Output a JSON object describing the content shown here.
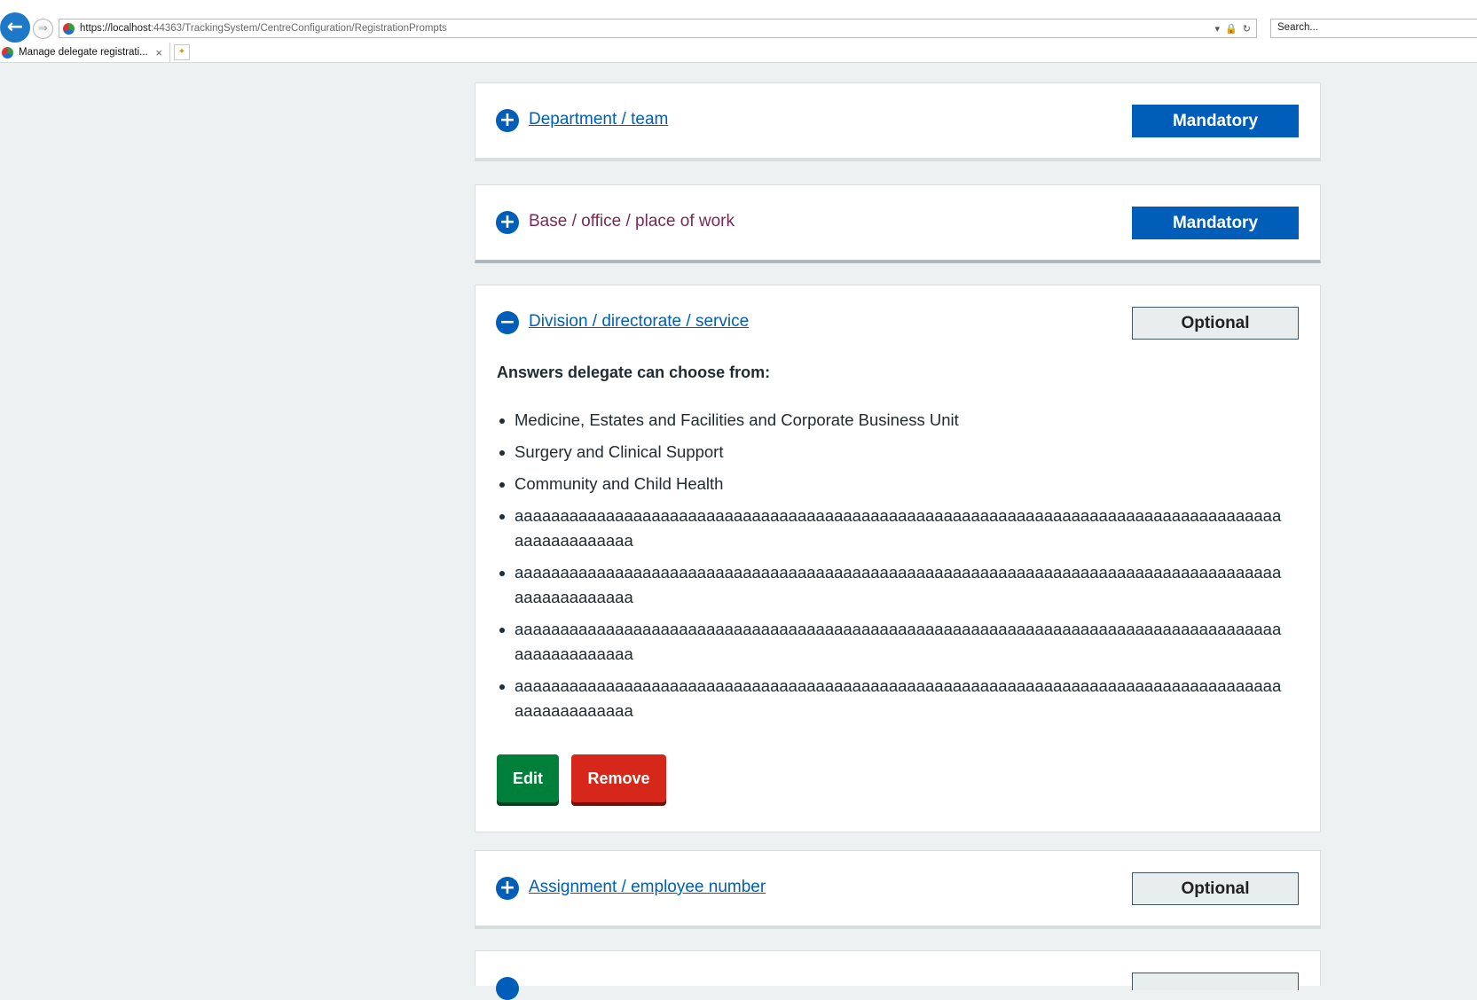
{
  "browser": {
    "url_host": "https://localhost",
    "url_rest": ":44363/TrackingSystem/CentreConfiguration/RegistrationPrompts",
    "search_placeholder": "Search...",
    "tab_title": "Manage delegate registrati...",
    "tab_close": "×"
  },
  "prompts": [
    {
      "title": "Department / team",
      "tag": "Mandatory"
    },
    {
      "title": "Base / office / place of work",
      "tag": "Mandatory"
    },
    {
      "title": "Division / directorate / service",
      "tag": "Optional",
      "answers_title": "Answers delegate can choose from:",
      "answers": [
        "Medicine, Estates and Facilities and Corporate Business Unit",
        "Surgery and Clinical Support",
        "Community and Child Health",
        "aaaaaaaaaaaaaaaaaaaaaaaaaaaaaaaaaaaaaaaaaaaaaaaaaaaaaaaaaaaaaaaaaaaaaaaaaaaaaaaaaaaaaaaaaaaaaaaaa",
        "aaaaaaaaaaaaaaaaaaaaaaaaaaaaaaaaaaaaaaaaaaaaaaaaaaaaaaaaaaaaaaaaaaaaaaaaaaaaaaaaaaaaaaaaaaaaaaaaa",
        "aaaaaaaaaaaaaaaaaaaaaaaaaaaaaaaaaaaaaaaaaaaaaaaaaaaaaaaaaaaaaaaaaaaaaaaaaaaaaaaaaaaaaaaaaaaaaaaaa",
        "aaaaaaaaaaaaaaaaaaaaaaaaaaaaaaaaaaaaaaaaaaaaaaaaaaaaaaaaaaaaaaaaaaaaaaaaaaaaaaaaaaaaaaaaaaaaaaaaa"
      ],
      "edit_label": "Edit",
      "remove_label": "Remove"
    },
    {
      "title": "Assignment / employee number",
      "tag": "Optional"
    }
  ],
  "colors": {
    "nhs_blue": "#005eb8",
    "visited_link": "#7c2855",
    "edit_green": "#007f3b",
    "remove_red": "#d5281b",
    "page_bg": "#eef1f2"
  },
  "icons": {
    "back": "arrow-left-icon",
    "forward": "arrow-right-icon",
    "expand": "plus-circle-icon",
    "collapse": "minus-circle-icon"
  }
}
